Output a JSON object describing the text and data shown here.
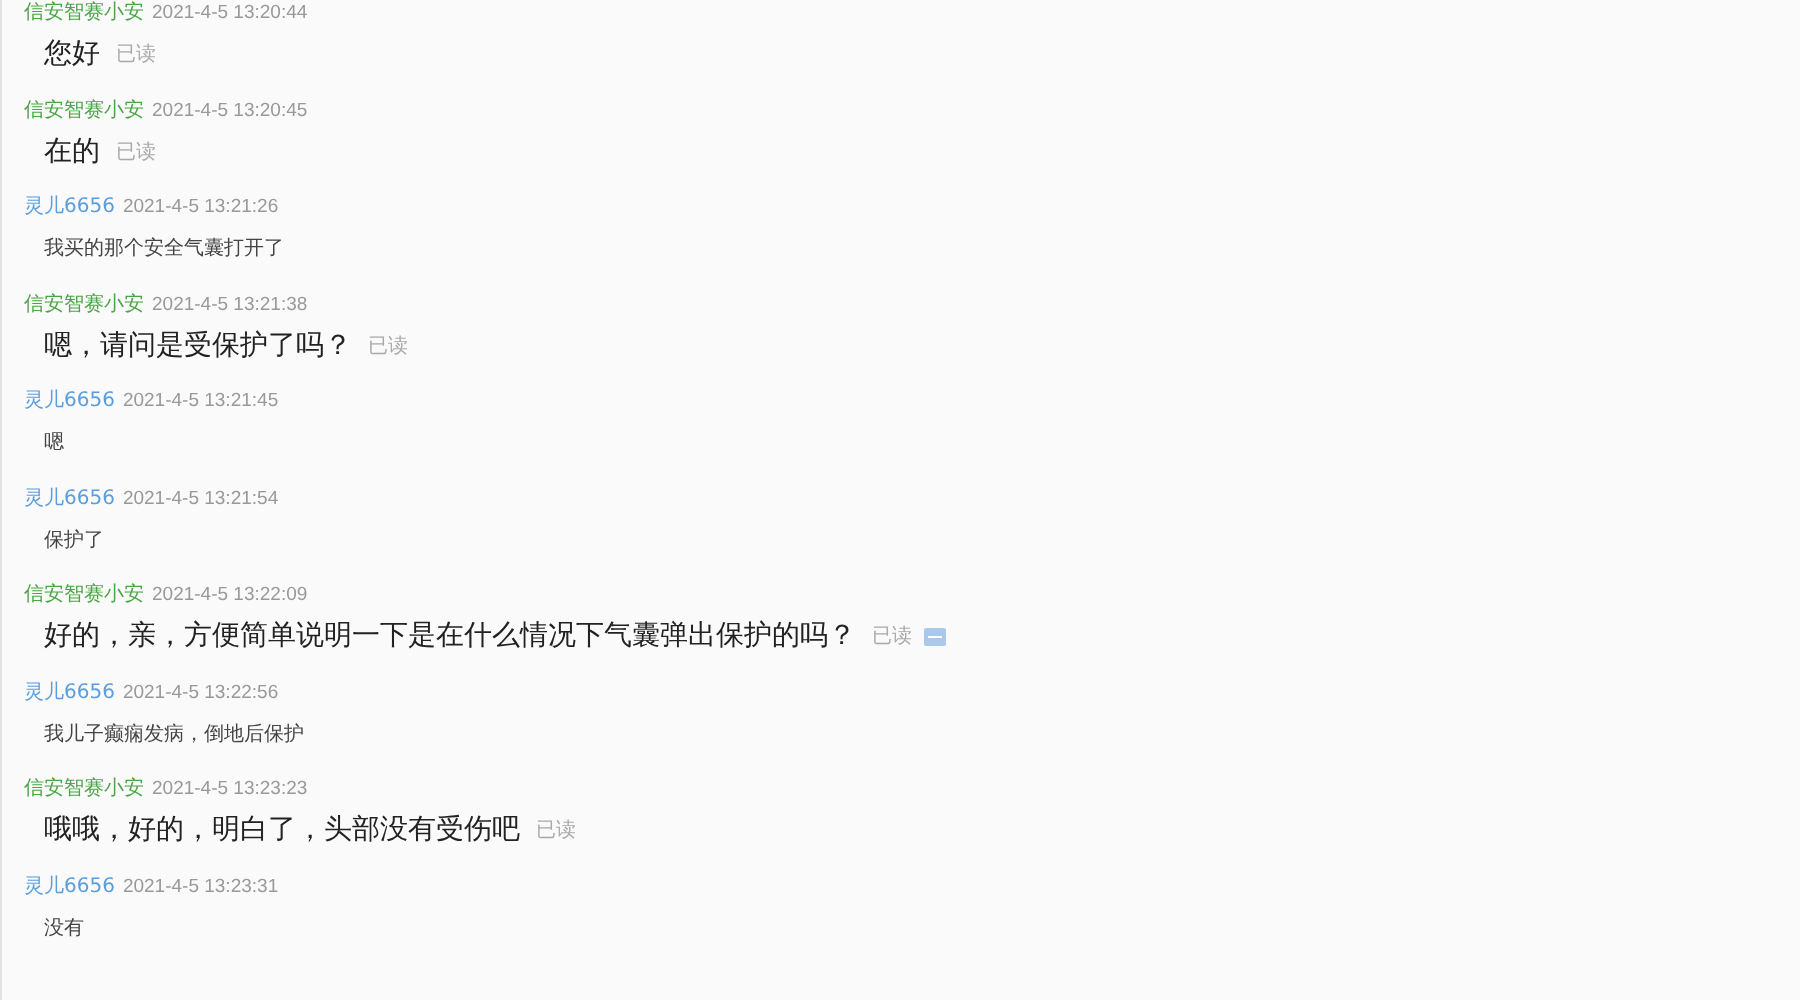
{
  "messages": [
    {
      "kind": "agent",
      "sender": "信安智赛小安",
      "time": "2021-4-5 13:20:44",
      "text": "您好",
      "status": "已读",
      "menu_icon": false
    },
    {
      "kind": "agent",
      "sender": "信安智赛小安",
      "time": "2021-4-5 13:20:45",
      "text": "在的",
      "status": "已读",
      "menu_icon": false
    },
    {
      "kind": "customer",
      "sender": "灵儿6656",
      "time": "2021-4-5 13:21:26",
      "text": "我买的那个安全气囊打开了"
    },
    {
      "kind": "agent",
      "sender": "信安智赛小安",
      "time": "2021-4-5 13:21:38",
      "text": "嗯，请问是受保护了吗？",
      "status": "已读",
      "menu_icon": false
    },
    {
      "kind": "customer",
      "sender": "灵儿6656",
      "time": "2021-4-5 13:21:45",
      "text": "嗯"
    },
    {
      "kind": "customer",
      "sender": "灵儿6656",
      "time": "2021-4-5 13:21:54",
      "text": "保护了"
    },
    {
      "kind": "agent",
      "sender": "信安智赛小安",
      "time": "2021-4-5 13:22:09",
      "text": "好的，亲，方便简单说明一下是在什么情况下气囊弹出保护的吗？",
      "status": "已读",
      "menu_icon": true
    },
    {
      "kind": "customer",
      "sender": "灵儿6656",
      "time": "2021-4-5 13:22:56",
      "text": "我儿子癫痫发病，倒地后保护"
    },
    {
      "kind": "agent",
      "sender": "信安智赛小安",
      "time": "2021-4-5 13:23:23",
      "text": "哦哦，好的，明白了，头部没有受伤吧",
      "status": "已读",
      "menu_icon": false
    },
    {
      "kind": "customer",
      "sender": "灵儿6656",
      "time": "2021-4-5 13:23:31",
      "text": "没有"
    }
  ]
}
